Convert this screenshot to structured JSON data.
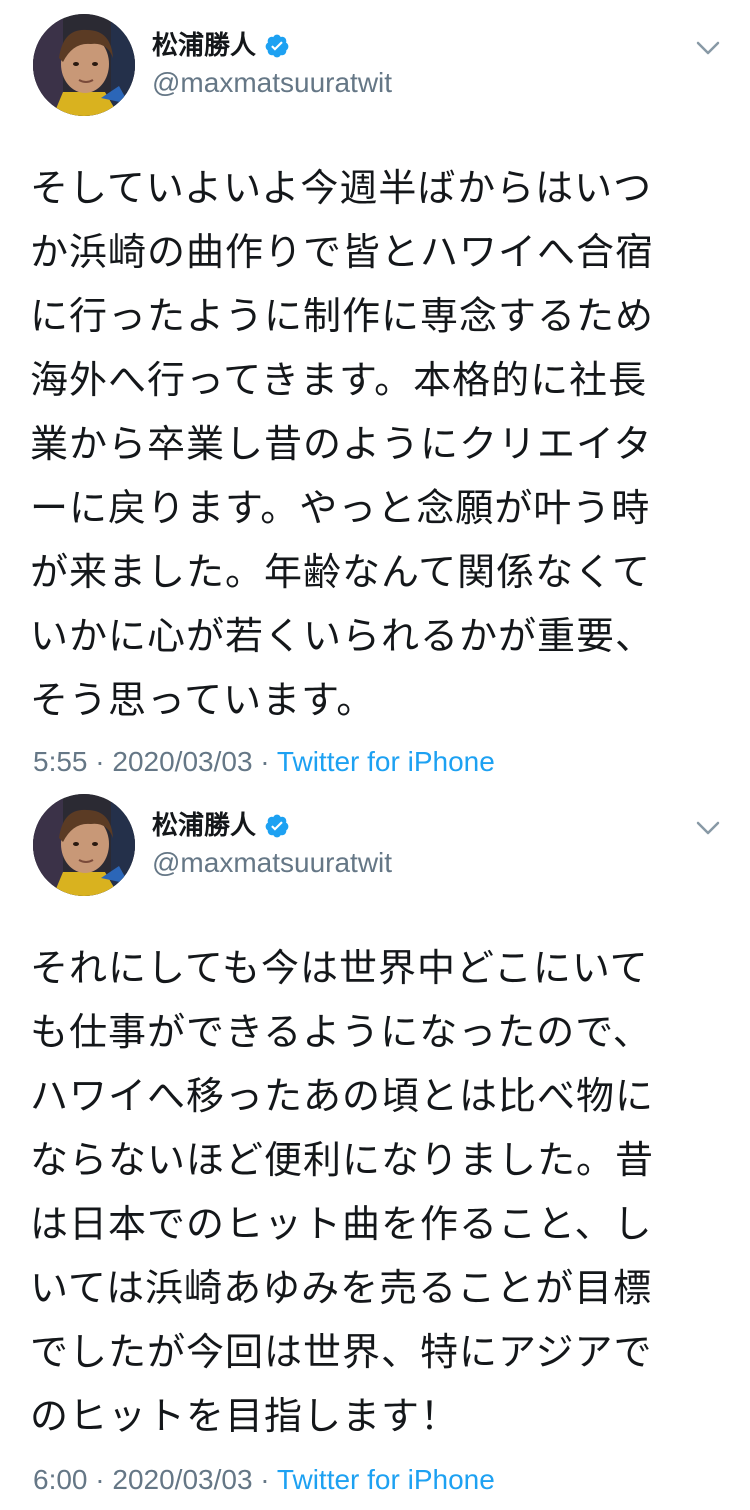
{
  "tweets": [
    {
      "display_name": "松浦勝人",
      "handle": "@maxmatsuuratwit",
      "verified": true,
      "text": "そしていよいよ今週半ばからはいつ\nか浜崎の曲作りで皆とハワイへ合宿\nに行ったように制作に専念するため\n海外へ行ってきます。本格的に社長\n業から卒業し昔のようにクリエイタ\nーに戻ります。やっと念願が叶う時\nが来ました。年齢なんて関係なくて\nいかに心が若くいられるかが重要、\nそう思っています。",
      "time": "5:55",
      "separator": " · ",
      "date": "2020/03/03",
      "source": "Twitter for iPhone"
    },
    {
      "display_name": "松浦勝人",
      "handle": "@maxmatsuuratwit",
      "verified": true,
      "text": "それにしても今は世界中どこにいて\nも仕事ができるようになったので、\nハワイへ移ったあの頃とは比べ物に\nならないほど便利になりました。昔\nは日本でのヒット曲を作ること、し\nいては浜崎あゆみを売ることが目標\nでしたが今回は世界、特にアジアで\nのヒットを目指します！",
      "time": "6:00",
      "separator": " · ",
      "date": "2020/03/03",
      "source": "Twitter for iPhone"
    }
  ],
  "colors": {
    "text": "#14171a",
    "secondary": "#657786",
    "link": "#1da1f2",
    "verified": "#1da1f2"
  },
  "icons": {
    "verified": "verified-badge-icon",
    "caret": "chevron-down-icon"
  }
}
